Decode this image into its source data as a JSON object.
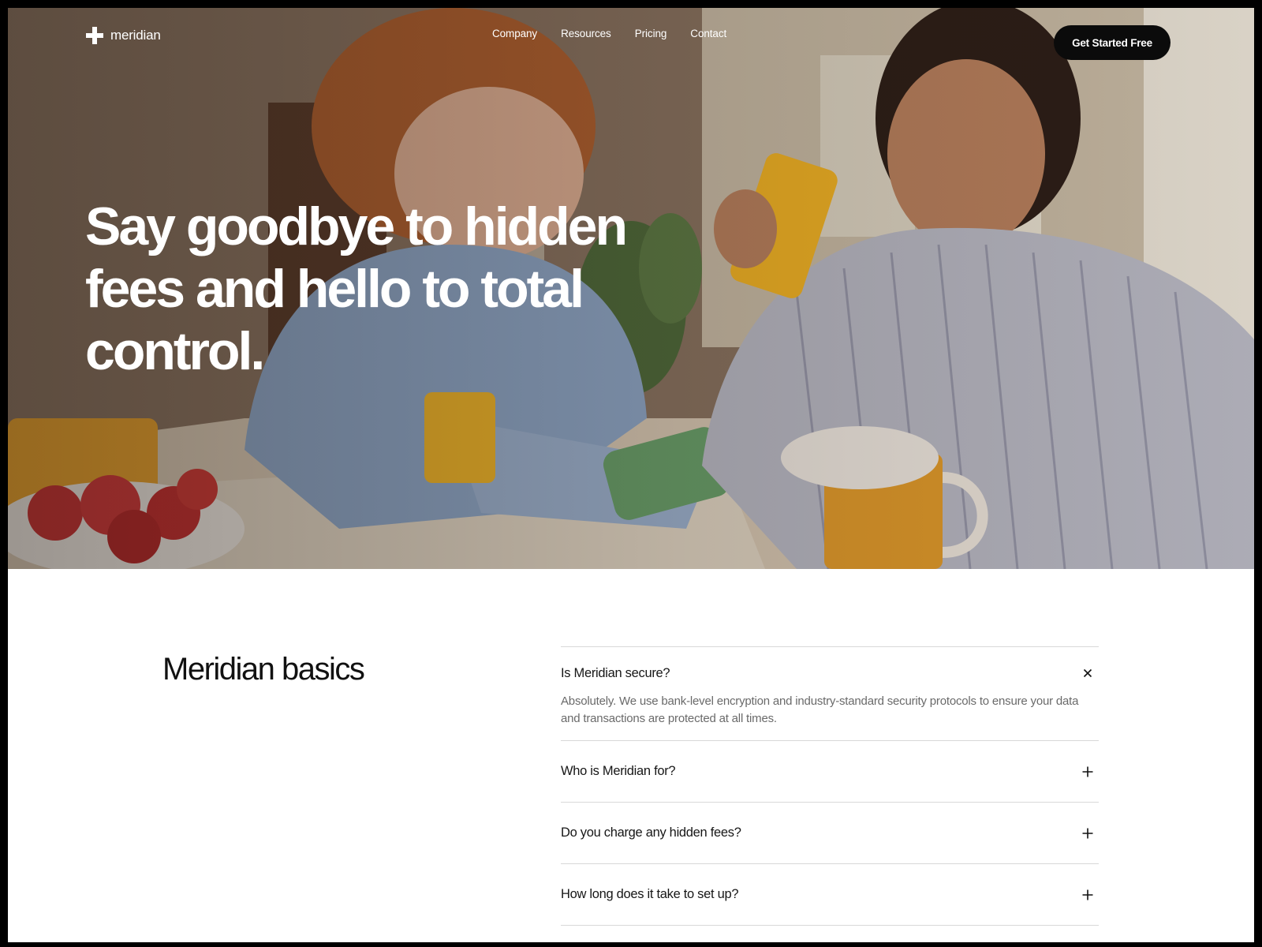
{
  "brand": {
    "name": "meridian",
    "accent": "#0b0b0b"
  },
  "nav": {
    "links": [
      "Company",
      "Resources",
      "Pricing",
      "Contact"
    ],
    "cta_label": "Get Started Free"
  },
  "hero": {
    "headline": "Say goodbye to hidden fees and hello to total control.",
    "image_icon": "photo-couple-breakfast"
  },
  "faq": {
    "title": "Meridian basics",
    "items": [
      {
        "question": "Is Meridian secure?",
        "answer": "Absolutely. We use bank-level encryption and industry-standard security protocols to ensure your data and transactions are protected at all times.",
        "expanded": true,
        "icon": "close-icon"
      },
      {
        "question": "Who is Meridian for?",
        "expanded": false,
        "icon": "plus-icon"
      },
      {
        "question": "Do you charge any hidden fees?",
        "expanded": false,
        "icon": "plus-icon"
      },
      {
        "question": "How long does it take to set up?",
        "expanded": false,
        "icon": "plus-icon"
      }
    ]
  }
}
